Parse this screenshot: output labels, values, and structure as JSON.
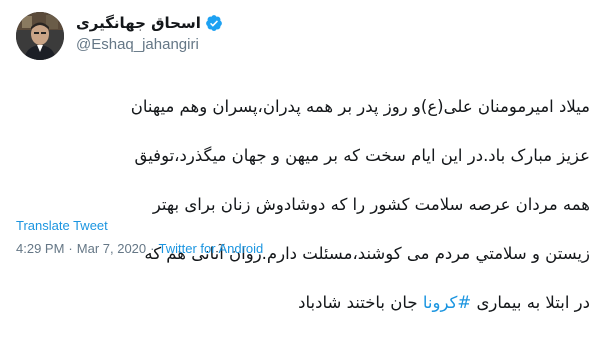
{
  "tweet": {
    "display_name": "اسحاق جهانگیری",
    "handle": "@Eshaq_jahangiri",
    "verified_icon": "verified-badge-icon",
    "body_lines": [
      "میلاد امیرمومنان علی(ع)و روز پدر بر همه پدران،پسران وهم میهنان",
      "عزیز مبارک باد.در این ایام سخت که بر میهن و جهان میگذرد،توفیق",
      "همه مردان عرصه سلامت کشور را که دوشادوش زنان برای بهتر",
      "زیستن و سلامتي مردم می کوشند،مسئلت دارم.روان آنانی هم که"
    ],
    "last_line_before": "در ابتلا به بیماری ",
    "hashtag": "#کرونا",
    "last_line_after": " جان باختند شادباد",
    "translate_label": "Translate Tweet",
    "time": "4:29 PM",
    "separator": "·",
    "date": "Mar 7, 2020",
    "source": "Twitter for Android",
    "colors": {
      "link": "#1b95e0",
      "muted": "#657786",
      "text": "#14171a"
    }
  }
}
